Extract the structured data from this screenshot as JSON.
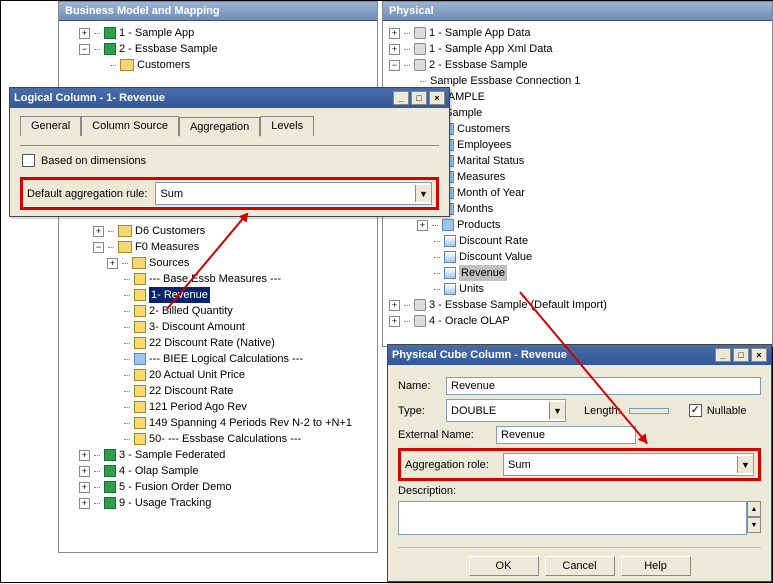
{
  "left_panel": {
    "title": "Business Model and Mapping",
    "items": {
      "sample_app": "1 - Sample App",
      "essbase_sample": "2 - Essbase Sample",
      "customers": "Customers",
      "d6_customers": "D6 Customers",
      "f0_measures": "F0 Measures",
      "sources": "Sources",
      "base_essb": "---  Base Essb Measures  ---",
      "revenue": "1- Revenue",
      "billed_qty": "2- Billed Quantity",
      "discount_amt": "3- Discount Amount",
      "discount_rate_native": "22  Discount Rate (Native)",
      "biee_logical": "---  BIEE Logical Calculations  ---",
      "actual_unit_price": "20  Actual Unit Price",
      "discount_rate": "22  Discount Rate",
      "period_ago_rev": "121  Period Ago Rev",
      "spanning": "149  Spanning 4 Periods Rev N-2 to +N+1",
      "essbase_calc": "50- --- Essbase Calculations ---",
      "sample_federated": "3 - Sample Federated",
      "olap_sample": "4 - Olap Sample",
      "fusion_order": "5 - Fusion Order Demo",
      "usage_tracking": "9 - Usage Tracking"
    }
  },
  "right_panel": {
    "title": "Physical",
    "items": {
      "sample_app_data": "1 - Sample App Data",
      "sample_app_xml": "1 - Sample App Xml Data",
      "essbase_sample": "2 - Essbase Sample",
      "conn": "Sample Essbase Connection 1",
      "bisample": "BISAMPLE",
      "sample": "Sample",
      "customers": "Customers",
      "employees": "Employees",
      "marital_status": "Marital Status",
      "measures": "Measures",
      "month_of_year": "Month of Year",
      "months": "Months",
      "products": "Products",
      "discount_rate": "Discount Rate",
      "discount_value": "Discount Value",
      "revenue": "Revenue",
      "units": "Units",
      "essbase_default": "3 - Essbase Sample (Default Import)",
      "oracle_olap": "4 - Oracle OLAP"
    }
  },
  "logical_dialog": {
    "title": "Logical Column - 1- Revenue",
    "tabs": {
      "general": "General",
      "column_source": "Column Source",
      "aggregation": "Aggregation",
      "levels": "Levels"
    },
    "based_on_dim": "Based on dimensions",
    "default_agg_label": "Default aggregation rule:",
    "default_agg_value": "Sum"
  },
  "physical_dialog": {
    "title": "Physical Cube Column - Revenue",
    "name_label": "Name:",
    "name_value": "Revenue",
    "type_label": "Type:",
    "type_value": "DOUBLE",
    "length_label": "Length:",
    "length_value": "",
    "nullable_label": "Nullable",
    "external_name_label": "External Name:",
    "external_name_value": "Revenue",
    "agg_role_label": "Aggregation role:",
    "agg_role_value": "Sum",
    "description_label": "Description:",
    "description_value": "",
    "btn_ok": "OK",
    "btn_cancel": "Cancel",
    "btn_help": "Help"
  }
}
